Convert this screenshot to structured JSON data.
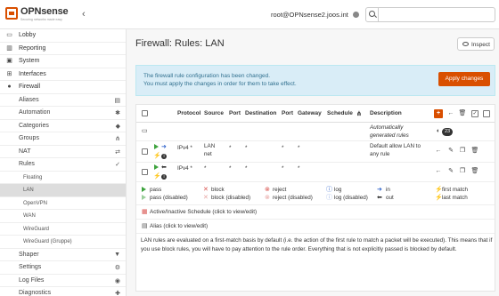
{
  "header": {
    "logo_text": "OPNsense",
    "logo_tag": "Securing networks made easy",
    "user": "root@OPNsense2.joos.int"
  },
  "sidebar": {
    "items": [
      {
        "label": "Lobby",
        "icon": "laptop-icon"
      },
      {
        "label": "Reporting",
        "icon": "chart-icon"
      },
      {
        "label": "System",
        "icon": "computer-icon"
      },
      {
        "label": "Interfaces",
        "icon": "network-icon"
      },
      {
        "label": "Firewall",
        "icon": "fire-icon"
      }
    ],
    "firewall_sub": [
      {
        "label": "Aliases",
        "icon": "list-icon"
      },
      {
        "label": "Automation",
        "icon": "gear-icon"
      },
      {
        "label": "Categories",
        "icon": "tag-icon"
      },
      {
        "label": "Groups",
        "icon": "sitemap-icon"
      },
      {
        "label": "NAT",
        "icon": "exchange-icon"
      },
      {
        "label": "Rules",
        "icon": "check-icon"
      }
    ],
    "rules_sub": [
      "Floating",
      "LAN",
      "OpenVPN",
      "WAN",
      "WireGuard",
      "WireGuard (Gruppe)"
    ],
    "bottom": [
      {
        "label": "Shaper",
        "icon": "filter-icon"
      },
      {
        "label": "Settings",
        "icon": "cogs-icon"
      },
      {
        "label": "Log Files",
        "icon": "eye-icon"
      },
      {
        "label": "Diagnostics",
        "icon": "medkit-icon"
      }
    ]
  },
  "main": {
    "title": "Firewall: Rules: LAN",
    "inspect_label": "Inspect",
    "alert_line1": "The firewall rule configuration has been changed.",
    "alert_line2": "You must apply the changes in order for them to take effect.",
    "apply_label": "Apply changes",
    "columns": [
      "Protocol",
      "Source",
      "Port",
      "Destination",
      "Port",
      "Gateway",
      "Schedule",
      "Description"
    ],
    "auto_rules": {
      "description_l1": "Automatically",
      "description_l2": "generated rules",
      "count": "23"
    },
    "rule_rows": [
      {
        "protocol": "IPv4 *",
        "source_l1": "LAN",
        "source_l2": "net",
        "port": "*",
        "destination": "*",
        "dport": "*",
        "gateway": "*",
        "schedule": "",
        "description_l1": "Default allow LAN to",
        "description_l2": "any rule",
        "direction": "in"
      },
      {
        "protocol": "IPv4 *",
        "source_l1": "*",
        "source_l2": "",
        "port": "*",
        "destination": "*",
        "dport": "*",
        "gateway": "*",
        "schedule": "",
        "description_l1": "",
        "description_l2": "",
        "direction": "out"
      }
    ],
    "legend": {
      "pass": "pass",
      "pass_disabled": "pass (disabled)",
      "block": "block",
      "block_disabled": "block (disabled)",
      "reject": "reject",
      "reject_disabled": "reject (disabled)",
      "log": "log",
      "log_disabled": "log (disabled)",
      "in": "in",
      "out": "out",
      "first_match": "first match",
      "last_match": "last match",
      "schedule": "Active/Inactive Schedule (click to view/edit)",
      "alias": "Alias (click to view/edit)"
    },
    "footer": "LAN rules are evaluated on a first-match basis by default (i.e. the action of the first rule to match a packet will be executed). This means that if you use block rules, you will have to pay attention to the rule order. Everything that is not explicitly passed is blocked by default."
  },
  "colors": {
    "brand": "#d94f00",
    "pass": "#3ea33e",
    "block": "#d9534f",
    "alert_bg": "#d9edf7"
  }
}
